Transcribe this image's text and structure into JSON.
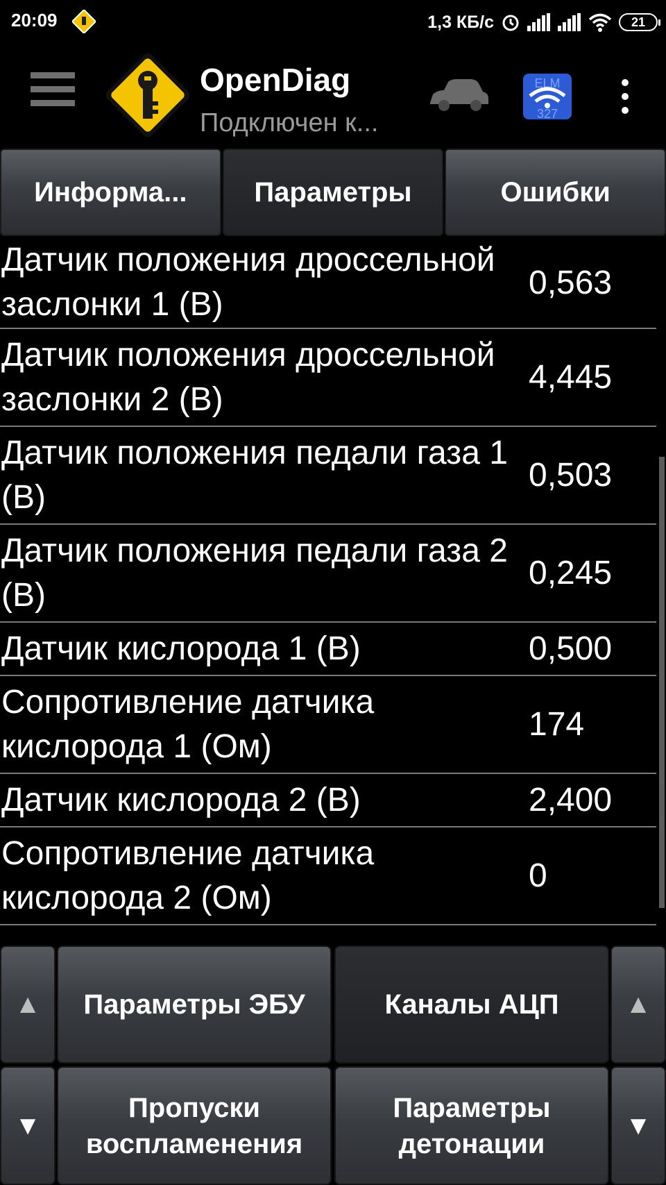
{
  "status_bar": {
    "time": "20:09",
    "network_speed": "1,3 КБ/с",
    "battery": "21",
    "icons": [
      "app-notification-icon",
      "alarm-icon",
      "signal-icon",
      "signal-icon",
      "wifi-icon",
      "battery-icon"
    ]
  },
  "action_bar": {
    "title": "OpenDiag",
    "subtitle": "Подключен к...",
    "icons": [
      "menu-icon",
      "app-logo-icon",
      "car-icon",
      "elm327-wifi-icon",
      "overflow-menu-icon"
    ],
    "elm_label": "ELM 327"
  },
  "tabs": [
    {
      "label": "Информа...",
      "active": false
    },
    {
      "label": "Параметры",
      "active": true
    },
    {
      "label": "Ошибки",
      "active": false
    }
  ],
  "parameters": [
    {
      "name": "Датчик положения дроссельной заслонки 1 (В)",
      "value": "0,563"
    },
    {
      "name": "Датчик положения дроссельной заслонки 2 (В)",
      "value": "4,445"
    },
    {
      "name": "Датчик положения педали газа 1 (В)",
      "value": "0,503"
    },
    {
      "name": "Датчик положения педали газа 2 (В)",
      "value": "0,245"
    },
    {
      "name": "Датчик кислорода 1 (В)",
      "value": "0,500"
    },
    {
      "name": "Сопротивление датчика кислорода 1 (Ом)",
      "value": "174"
    },
    {
      "name": "Датчик кислорода 2 (В)",
      "value": "2,400"
    },
    {
      "name": "Сопротивление датчика кислорода 2 (Ом)",
      "value": "0"
    }
  ],
  "bottom_buttons": {
    "up_arrow": "▲",
    "down_arrow": "▼",
    "ecu_params": "Параметры ЭБУ",
    "adc_channels": "Каналы АЦП",
    "misfires": "Пропуски воспламенения",
    "knock_params": "Параметры детонации"
  },
  "colors": {
    "background": "#000000",
    "logo_yellow": "#f5c400",
    "divider": "#7a7a7a",
    "subtitle": "#9a9a9a"
  }
}
